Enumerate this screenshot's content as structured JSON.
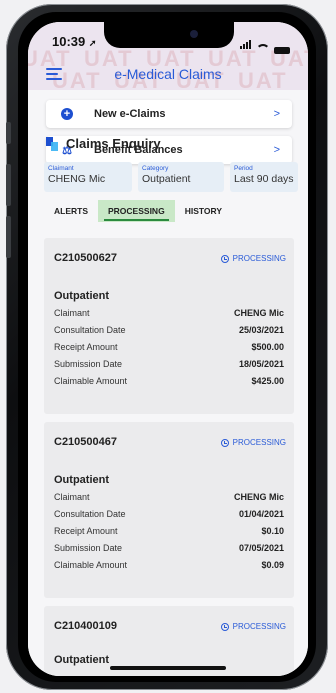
{
  "status_bar": {
    "time": "10:39"
  },
  "header": {
    "title": "e-Medical Claims",
    "watermark": "UAT"
  },
  "actions": [
    {
      "label": "New e-Claims",
      "icon": "plus-circle-icon"
    },
    {
      "label": "Benefit Balances",
      "icon": "scale-icon"
    }
  ],
  "enquiry": {
    "title": "Claims Enquiry",
    "filters": [
      {
        "key": "Claimant",
        "value": "CHENG Mic"
      },
      {
        "key": "Category",
        "value": "Outpatient"
      },
      {
        "key": "Period",
        "value": "Last 90 days"
      }
    ],
    "tabs": [
      "ALERTS",
      "PROCESSING",
      "HISTORY"
    ],
    "active_tab": "PROCESSING"
  },
  "field_labels": {
    "claimant": "Claimant",
    "consultation_date": "Consultation Date",
    "receipt_amount": "Receipt Amount",
    "submission_date": "Submission Date",
    "claimable_amount": "Claimable Amount"
  },
  "claims": [
    {
      "number": "C210500627",
      "status": "PROCESSING",
      "category": "Outpatient",
      "claimant": "CHENG Mic",
      "consultation_date": "25/03/2021",
      "receipt_amount": "$500.00",
      "submission_date": "18/05/2021",
      "claimable_amount": "$425.00"
    },
    {
      "number": "C210500467",
      "status": "PROCESSING",
      "category": "Outpatient",
      "claimant": "CHENG Mic",
      "consultation_date": "01/04/2021",
      "receipt_amount": "$0.10",
      "submission_date": "07/05/2021",
      "claimable_amount": "$0.09"
    },
    {
      "number": "C210400109",
      "status": "PROCESSING",
      "category": "Outpatient"
    }
  ],
  "colors": {
    "accent": "#2a5bd7",
    "active_tab": "#c9e8c7",
    "card": "#ebebed"
  }
}
